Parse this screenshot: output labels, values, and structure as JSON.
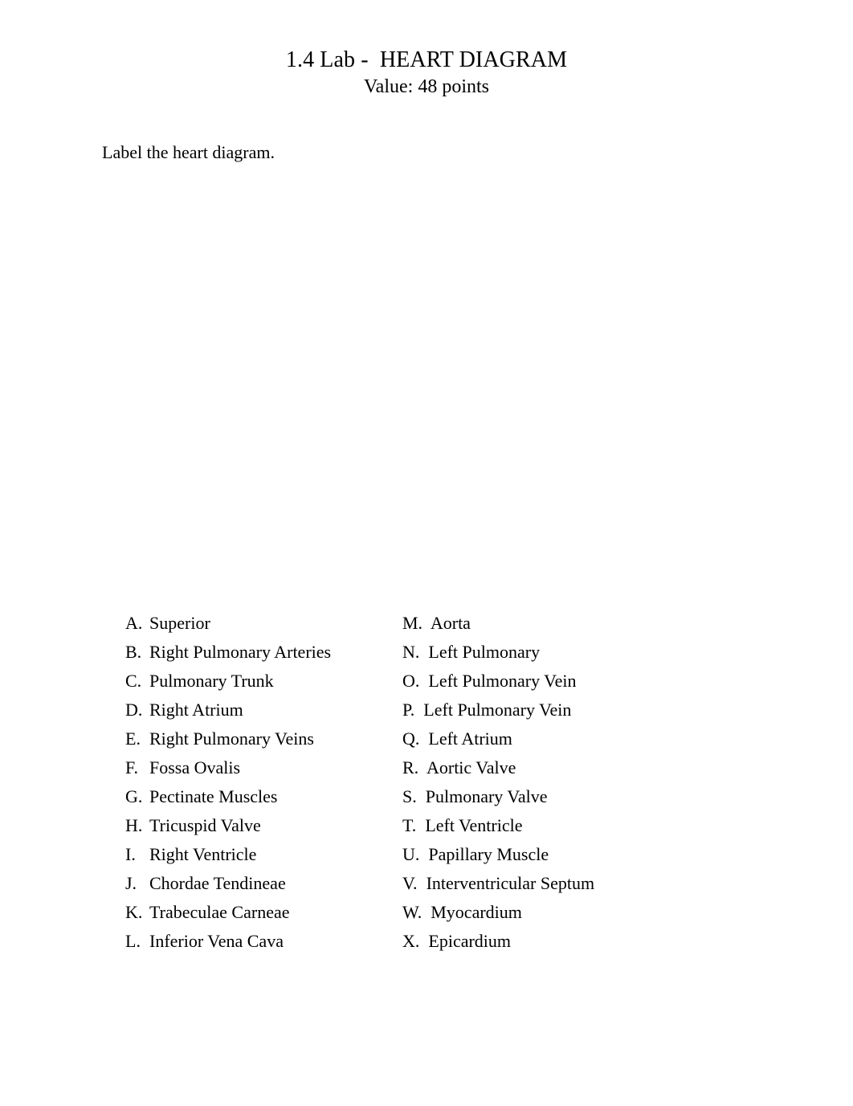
{
  "document": {
    "title": "1.4 Lab -  HEART DIAGRAM",
    "subtitle": "Value: 48 points",
    "instruction": "Label the heart diagram."
  },
  "list": {
    "left_column": [
      {
        "marker": "A.",
        "label": "Superior"
      },
      {
        "marker": "B.",
        "label": "Right Pulmonary Arteries"
      },
      {
        "marker": "C.",
        "label": "Pulmonary Trunk"
      },
      {
        "marker": "D.",
        "label": "Right Atrium"
      },
      {
        "marker": "E.",
        "label": "Right Pulmonary Veins"
      },
      {
        "marker": "F.",
        "label": "Fossa Ovalis"
      },
      {
        "marker": "G.",
        "label": "Pectinate Muscles"
      },
      {
        "marker": "H.",
        "label": "Tricuspid Valve"
      },
      {
        "marker": "I.",
        "label": "Right Ventricle"
      },
      {
        "marker": "J.",
        "label": "Chordae Tendineae"
      },
      {
        "marker": "K.",
        "label": "Trabeculae Carneae"
      },
      {
        "marker": "L.",
        "label": "Inferior Vena Cava"
      }
    ],
    "right_column": [
      {
        "marker": "M.",
        "label": "Aorta"
      },
      {
        "marker": "N.",
        "label": "Left Pulmonary"
      },
      {
        "marker": "O.",
        "label": "Left Pulmonary Vein"
      },
      {
        "marker": "P.",
        "label": "Left Pulmonary Vein"
      },
      {
        "marker": "Q.",
        "label": "Left Atrium"
      },
      {
        "marker": "R.",
        "label": "Aortic Valve"
      },
      {
        "marker": "S.",
        "label": "Pulmonary Valve"
      },
      {
        "marker": "T.",
        "label": "Left Ventricle"
      },
      {
        "marker": "U.",
        "label": "Papillary Muscle"
      },
      {
        "marker": "V.",
        "label": "Interventricular Septum"
      },
      {
        "marker": "W.",
        "label": "Myocardium"
      },
      {
        "marker": "X.",
        "label": "Epicardium"
      }
    ]
  }
}
